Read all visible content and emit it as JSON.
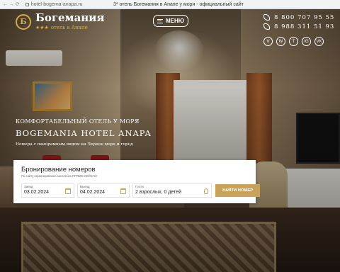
{
  "browser": {
    "nav_glyphs": "← → ⟳",
    "url": "hotel-bogema-anapa.ru",
    "tab_title": "3* отель Богемания в Анапе у моря - официальный сайт"
  },
  "header": {
    "logo": {
      "emblem": "Б",
      "name": "Богемания",
      "stars": "★★★",
      "subtitle": "отель в Анапе"
    },
    "menu_label": "МЕНЮ",
    "phones": [
      "8 800 707 95 55",
      "8 988 311 51 93"
    ],
    "socials": [
      "V",
      "W",
      "T",
      "IG",
      "VK"
    ]
  },
  "hero": {
    "line1": "КОМФОРТАБЕЛЬНЫЙ ОТЕЛЬ У МОРЯ",
    "line2": "BOGEMANIA HOTEL ANAPA",
    "line3": "Номера с панорамным видом на Черное море и город"
  },
  "booking": {
    "title": "Бронирование номеров",
    "note": "По сайту гарантированно заселение ПРЯМО СЕЙЧАС!",
    "checkin": {
      "label": "Заезд",
      "value": "03.02.2024"
    },
    "checkout": {
      "label": "Выезд",
      "value": "04.02.2024"
    },
    "guests": {
      "label": "Гости",
      "value": "2 взрослых, 0 детей"
    },
    "button": "НАЙТИ НОМЕР"
  },
  "colors": {
    "accent": "#c9a35a",
    "gold_logo": "#d4a94a"
  }
}
